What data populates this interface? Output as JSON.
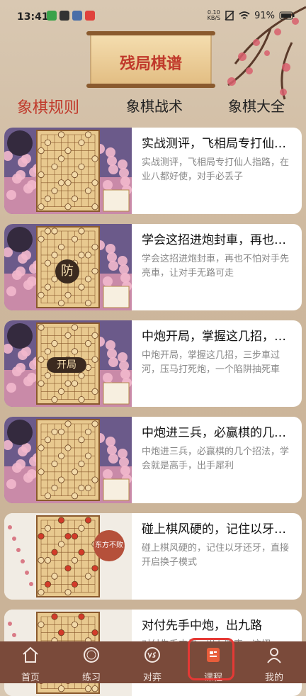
{
  "status_bar": {
    "time": "13:41",
    "speed_top": "0.10",
    "speed_bottom": "KB/S",
    "battery": "91%"
  },
  "banner": {
    "title": "残局棋谱"
  },
  "tabs": [
    {
      "label": "象棋规则",
      "active": true
    },
    {
      "label": "象棋战术",
      "active": false
    },
    {
      "label": "象棋大全",
      "active": false
    }
  ],
  "courses": [
    {
      "title": "实战测评，飞相局专打仙人指路，在业八都好使，对手必丢子",
      "desc": "实战测评，飞相局专打仙人指路，在业八都好使，对手必丢子"
    },
    {
      "title": "学会这招进炮封車，再也不怕对手先亮車，让对手无路可走",
      "desc": "学会这招进炮封車，再也不怕对手先亮車，让对手无路可走"
    },
    {
      "title": "中炮开局，掌握这几招，三步車过河，压马打死炮，一个陷阱抽死車",
      "desc": "中炮开局，掌握这几招，三步車过河，压马打死炮，一个陷阱抽死車"
    },
    {
      "title": "中炮进三兵，必赢棋的几个招法，学会就是高手，出手犀利",
      "desc": "中炮进三兵，必赢棋的几个招法，学会就是高手，出手犀利"
    },
    {
      "title": "碰上棋风硬的，记住以牙还牙，直接开启换子模式",
      "desc": "碰上棋风硬的，记住以牙还牙，直接开启换子模式"
    },
    {
      "title": "对付先手中炮，出九路",
      "desc": "对付先手中炮，出九路車，这招"
    }
  ],
  "thumb_overlays": {
    "card2_mark": "防",
    "card3_mark": "开局",
    "card5_seal": "东方不败"
  },
  "nav": [
    {
      "label": "首页",
      "icon": "home-icon",
      "active": false
    },
    {
      "label": "练习",
      "icon": "practice-icon",
      "active": false
    },
    {
      "label": "对弈",
      "icon": "versus-icon",
      "active": false
    },
    {
      "label": "课程",
      "icon": "course-icon",
      "active": true
    },
    {
      "label": "我的",
      "icon": "profile-icon",
      "active": false
    }
  ],
  "colors": {
    "accent": "#c0392b",
    "nav_bg": "#7a4a3a",
    "highlight": "#e53935"
  }
}
